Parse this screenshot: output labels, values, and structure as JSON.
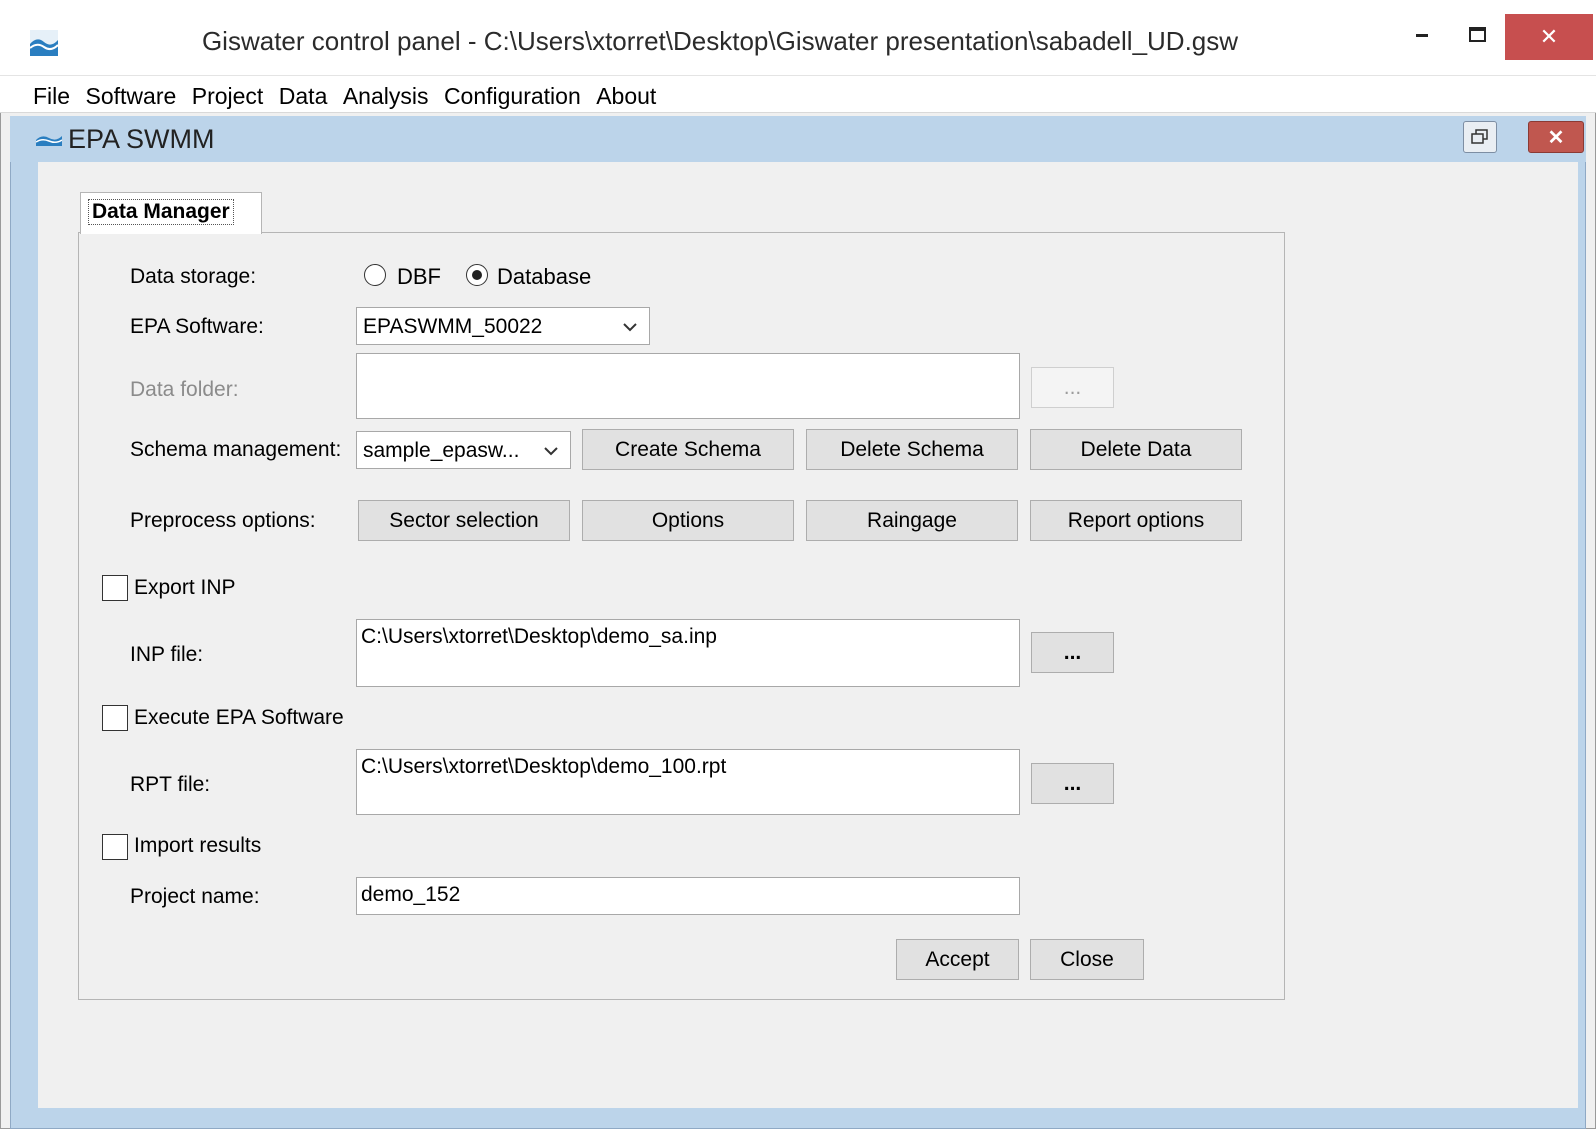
{
  "window": {
    "title": "Giswater control panel - C:\\Users\\xtorret\\Desktop\\Giswater presentation\\sabadell_UD.gsw",
    "minimize_glyph": "–",
    "maximize_glyph": "☐",
    "close_glyph": "✕"
  },
  "menu": [
    "File",
    "Software",
    "Project",
    "Data",
    "Analysis",
    "Configuration",
    "About"
  ],
  "inner_window": {
    "title": "EPA SWMM"
  },
  "tab": {
    "label": "Data Manager"
  },
  "form": {
    "data_storage": {
      "label": "Data storage:",
      "options": [
        {
          "label": "DBF",
          "checked": false
        },
        {
          "label": "Database",
          "checked": true
        }
      ]
    },
    "epa_software": {
      "label": "EPA Software:",
      "value": "EPASWMM_50022"
    },
    "data_folder": {
      "label": "Data folder:",
      "value": "",
      "browse_label": "..."
    },
    "schema_management": {
      "label": "Schema management:",
      "value": "sample_epasw...",
      "create_label": "Create Schema",
      "delete_schema_label": "Delete Schema",
      "delete_data_label": "Delete Data"
    },
    "preprocess": {
      "label": "Preprocess options:",
      "sector_label": "Sector selection",
      "options_label": "Options",
      "raingage_label": "Raingage",
      "report_label": "Report options"
    },
    "export_inp": {
      "label": "Export INP",
      "checked": false
    },
    "inp_file": {
      "label": "INP file:",
      "value": "C:\\Users\\xtorret\\Desktop\\demo_sa.inp",
      "browse_label": "..."
    },
    "execute_epa": {
      "label": "Execute EPA Software",
      "checked": false
    },
    "rpt_file": {
      "label": "RPT file:",
      "value": "C:\\Users\\xtorret\\Desktop\\demo_100.rpt",
      "browse_label": "..."
    },
    "import_results": {
      "label": "Import results",
      "checked": false
    },
    "project_name": {
      "label": "Project name:",
      "value": "demo_152"
    },
    "accept_label": "Accept",
    "close_label": "Close"
  },
  "colors": {
    "titlebar_close": "#c74f4f",
    "mdi_frame": "#bcd4ea",
    "panel_bg": "#f0f0f0"
  }
}
